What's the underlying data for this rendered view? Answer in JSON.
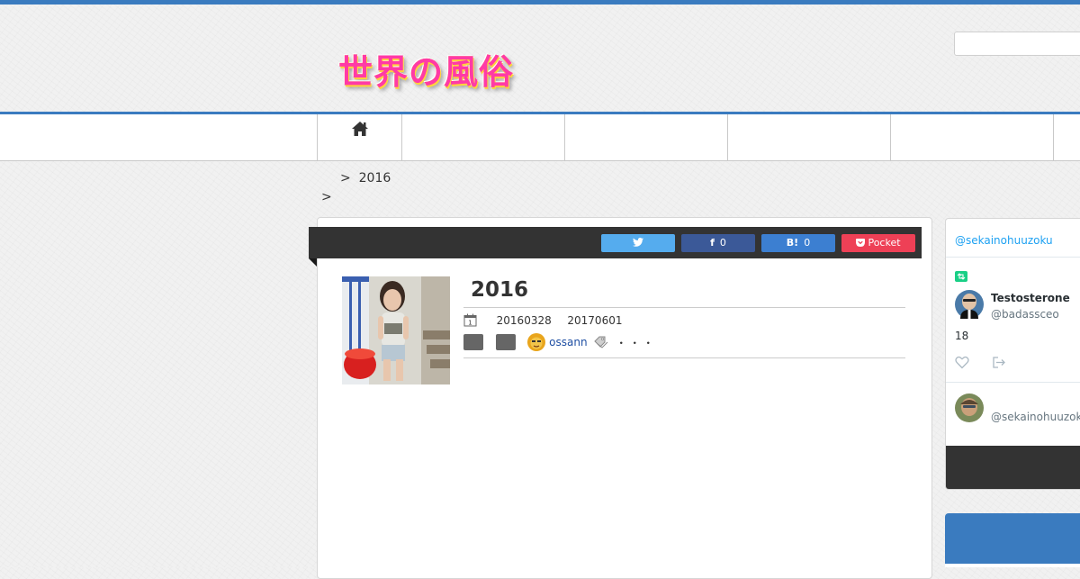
{
  "header": {
    "logo_text": "世界の風俗",
    "search_value": ""
  },
  "breadcrumb": {
    "separator": ">",
    "current": "2016"
  },
  "share": {
    "facebook_count": "0",
    "hatena_count": "0",
    "pocket_label": "Pocket"
  },
  "post": {
    "title": "2016",
    "date_published": "20160328",
    "date_updated": "20170601",
    "author": "ossann",
    "tags_trailing": "・・・"
  },
  "twitter_widget": {
    "account": "@sekainohuuzoku",
    "tweet_user_name": "Testosterone",
    "tweet_user_handle": "@badassceo",
    "tweet_text": "18",
    "footer_handle": "@sekainohuuzoku"
  },
  "colors": {
    "accent": "#3a7bbf",
    "twitter": "#55acee",
    "facebook": "#3b5998",
    "hatena": "#3c7fd1",
    "pocket": "#ee4056",
    "logo_pink": "#ff3aa6"
  },
  "icons": [
    "home-icon",
    "calendar-icon",
    "tag-icon",
    "twitter-icon",
    "facebook-icon",
    "hatena-icon",
    "pocket-icon",
    "heart-icon",
    "share-icon",
    "retweet-icon"
  ]
}
